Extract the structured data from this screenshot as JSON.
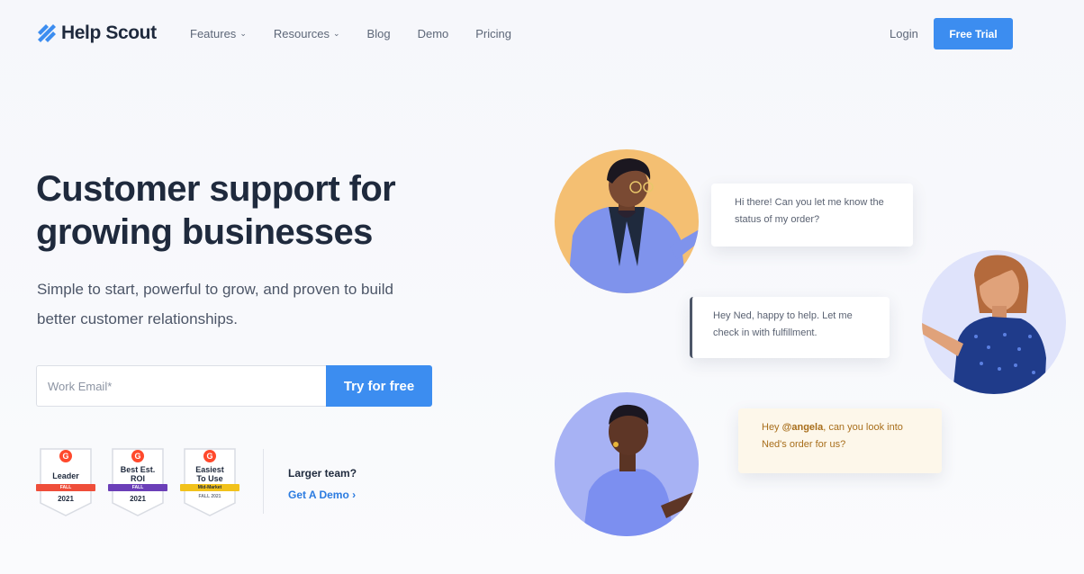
{
  "brand": {
    "name": "Help Scout",
    "accent": "#3c8df0",
    "logo_icon": "helpscout-logo-icon"
  },
  "nav": {
    "items": [
      {
        "label": "Features",
        "has_dropdown": true
      },
      {
        "label": "Resources",
        "has_dropdown": true
      },
      {
        "label": "Blog",
        "has_dropdown": false
      },
      {
        "label": "Demo",
        "has_dropdown": false
      },
      {
        "label": "Pricing",
        "has_dropdown": false
      }
    ],
    "chevron": "⌄",
    "login": "Login",
    "cta": "Free Trial"
  },
  "hero": {
    "title": "Customer support for growing businesses",
    "subtitle": "Simple to start, powerful to grow, and proven to build better customer relationships.",
    "email_placeholder": "Work Email*",
    "email_value": "",
    "try_button": "Try for free"
  },
  "badges": [
    {
      "title": "Leader",
      "ribbon": "FALL",
      "year": "2021",
      "ribbon_color": "#ef4e3a",
      "icon": "g2-badge-icon"
    },
    {
      "title": "Best Est. ROI",
      "ribbon": "FALL",
      "year": "2021",
      "ribbon_color": "#6b3fb8",
      "icon": "g2-badge-icon"
    },
    {
      "title": "Easiest To Use",
      "ribbon": "Mid-Market",
      "year": "FALL 2021",
      "ribbon_color": "#f2c21b",
      "icon": "g2-badge-icon"
    }
  ],
  "larger_team": {
    "label": "Larger team?",
    "link": "Get A Demo ›"
  },
  "chat": {
    "bubble1": "Hi there! Can you let me know the status of my order?",
    "bubble2": "Hey Ned, happy to help. Let me check in with fulfillment.",
    "bubble3_prefix": "Hey ",
    "bubble3_mention": "@angela",
    "bubble3_suffix": ", can you look into Ned's order for us?"
  }
}
